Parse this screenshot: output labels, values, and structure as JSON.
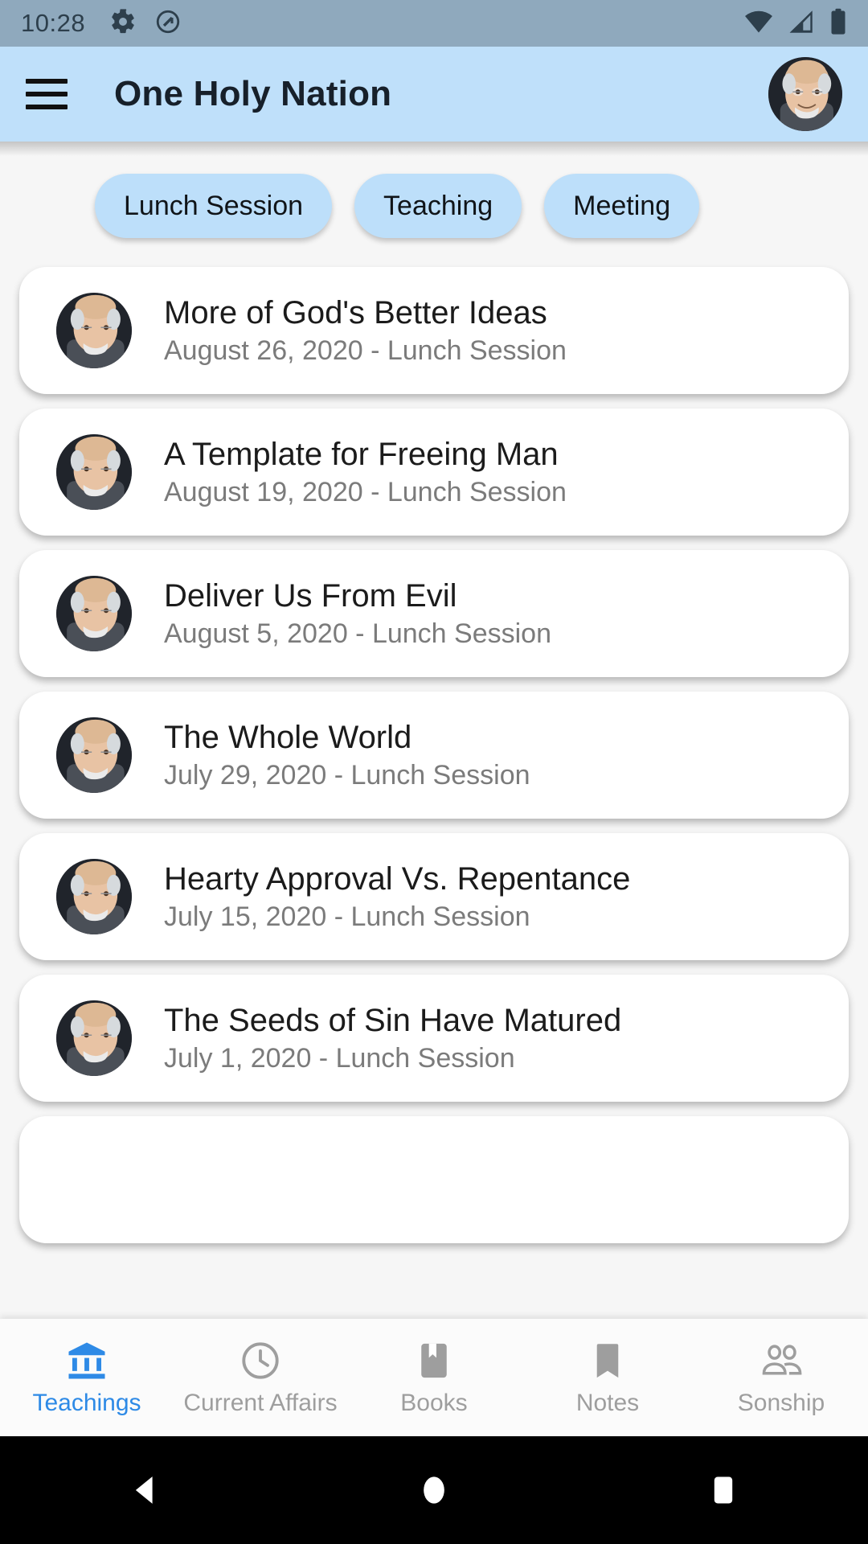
{
  "status_bar": {
    "time": "10:28",
    "icons_left": [
      "gear-icon",
      "do-not-disturb-icon"
    ],
    "icons_right": [
      "wifi-icon",
      "cellular-signal-icon",
      "battery-full-icon"
    ]
  },
  "app_bar": {
    "menu_icon": "hamburger-menu-icon",
    "title": "One Holy Nation",
    "avatar": "user-avatar",
    "background_color": "#bfe0fa"
  },
  "filter_chips": [
    {
      "label": "Lunch Session"
    },
    {
      "label": "Teaching"
    },
    {
      "label": "Meeting"
    }
  ],
  "teachings": [
    {
      "title": "More of God's Better Ideas",
      "subtitle": "August 26, 2020 - Lunch Session"
    },
    {
      "title": "A Template for Freeing Man",
      "subtitle": "August 19, 2020 - Lunch Session"
    },
    {
      "title": "Deliver Us From Evil",
      "subtitle": "August 5, 2020 - Lunch Session"
    },
    {
      "title": "The Whole World",
      "subtitle": "July 29, 2020 - Lunch Session"
    },
    {
      "title": "Hearty Approval Vs. Repentance",
      "subtitle": "July 15, 2020 - Lunch Session"
    },
    {
      "title": "The Seeds of Sin Have Matured",
      "subtitle": "July 1, 2020 - Lunch Session"
    }
  ],
  "bottom_nav": {
    "active_color": "#2e8ae6",
    "inactive_color": "#9e9e9e",
    "items": [
      {
        "label": "Teachings",
        "icon": "account-balance-icon",
        "active": true
      },
      {
        "label": "Current Affairs",
        "icon": "clock-icon",
        "active": false
      },
      {
        "label": "Books",
        "icon": "book-icon",
        "active": false
      },
      {
        "label": "Notes",
        "icon": "bookmark-icon",
        "active": false
      },
      {
        "label": "Sonship",
        "icon": "people-icon",
        "active": false
      }
    ]
  },
  "android_nav": {
    "back": "back-triangle-icon",
    "home": "home-circle-icon",
    "recents": "recents-square-icon"
  }
}
